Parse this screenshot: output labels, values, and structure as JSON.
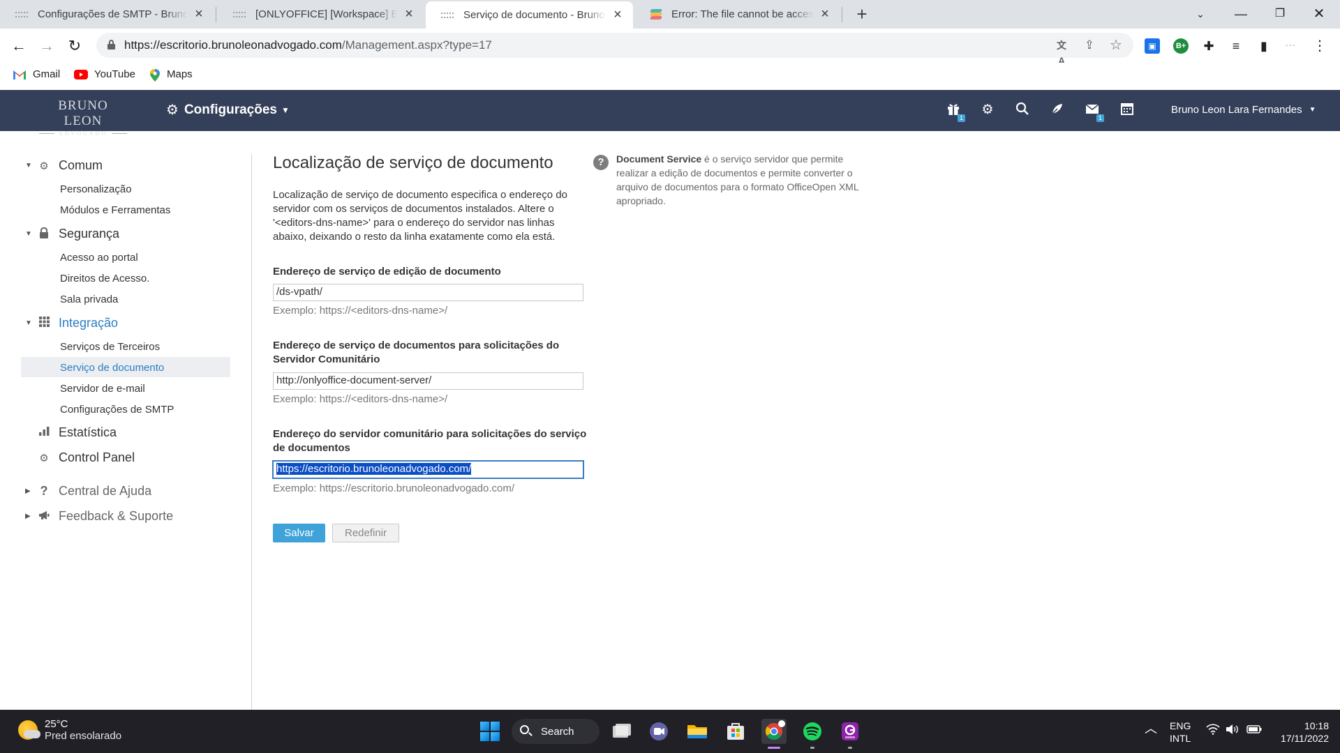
{
  "browser": {
    "tabs": [
      {
        "title": "Configurações de SMTP - Bruno Leon"
      },
      {
        "title": "[ONLYOFFICE] [Workspace] Error: Th"
      },
      {
        "title": "Serviço de documento - Bruno Leon"
      },
      {
        "title": "Error: The file cannot be accessed"
      }
    ],
    "new_tab": "+",
    "url_host": "https://escritorio.brunoleonadvogado.com",
    "url_path": "/Management.aspx?type=17",
    "bookmarks": [
      {
        "label": "Gmail"
      },
      {
        "label": "YouTube"
      },
      {
        "label": "Maps"
      }
    ]
  },
  "app": {
    "logo_line1": "BRUNO LEON",
    "logo_line2": "ADVOGADO",
    "module_label": "Configurações",
    "badges": {
      "gift": "1",
      "mail": "1"
    },
    "user_name": "Bruno Leon Lara Fernandes"
  },
  "sidebar": {
    "categories": [
      {
        "label": "Comum",
        "items": [
          "Personalização",
          "Módulos e Ferramentas"
        ]
      },
      {
        "label": "Segurança",
        "items": [
          "Acesso ao portal",
          "Direitos de Acesso.",
          "Sala privada"
        ]
      },
      {
        "label": "Integração",
        "items": [
          "Serviços de Terceiros",
          "Serviço de documento",
          "Servidor de e-mail",
          "Configurações de SMTP"
        ]
      },
      {
        "label": "Estatística",
        "items": []
      },
      {
        "label": "Control Panel",
        "items": []
      },
      {
        "label": "Central de Ajuda",
        "items": []
      },
      {
        "label": "Feedback & Suporte",
        "items": []
      }
    ]
  },
  "content": {
    "title": "Localização de serviço de documento",
    "description": "Localização de serviço de documento especifica o endereço do servidor com os serviços de documentos instalados. Altere o '<editors-dns-name>' para o endereço do servidor nas linhas abaixo, deixando o resto da linha exatamente como ela está.",
    "fields": [
      {
        "label": "Endereço de serviço de edição de documento",
        "value": "/ds-vpath/",
        "example": "Exemplo: https://<editors-dns-name>/"
      },
      {
        "label": "Endereço de serviço de documentos para solicitações do Servidor Comunitário",
        "value": "http://onlyoffice-document-server/",
        "example": "Exemplo: https://<editors-dns-name>/"
      },
      {
        "label": "Endereço do servidor comunitário para solicitações do serviço de documentos",
        "value": "https://escritorio.brunoleonadvogado.com/",
        "example": "Exemplo: https://escritorio.brunoleonadvogado.com/"
      }
    ],
    "save_label": "Salvar",
    "reset_label": "Redefinir"
  },
  "help": {
    "term": "Document Service",
    "text": " é o serviço servidor que permite realizar a edição de documentos e permite converter o arquivo de documentos para o formato OfficeOpen XML apropriado."
  },
  "taskbar": {
    "temperature": "25°C",
    "weather": "Pred ensolarado",
    "search_label": "Search",
    "lang1": "ENG",
    "lang2": "INTL",
    "time": "10:18",
    "date": "17/11/2022"
  }
}
